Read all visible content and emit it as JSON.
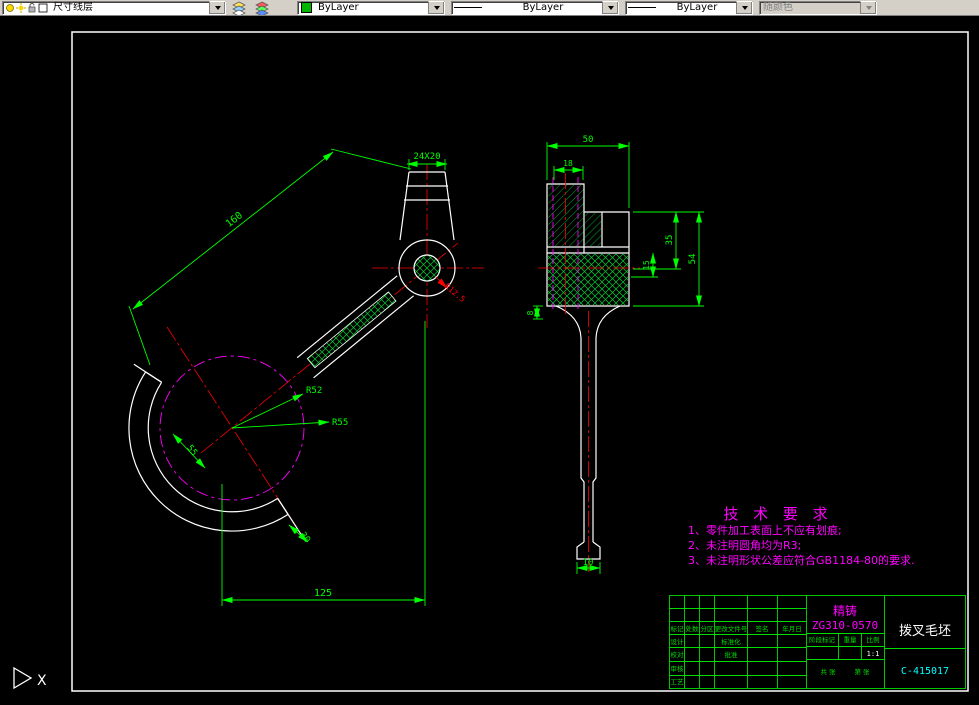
{
  "toolbar": {
    "layer_combo": "尺寸线层",
    "color_combo": "ByLayer",
    "linetype_combo": "ByLayer",
    "lineweight_combo": "ByLayer",
    "plotstyle_combo": "随颜色"
  },
  "colors": {
    "outline": "#ffffff",
    "dimension": "#00ff00",
    "centerline": "#ff0000",
    "phantom": "#ff00ff",
    "drawing_no": "#00ffff",
    "bylayer_swatch": "#00b400"
  },
  "drawing": {
    "left_view": {
      "dim_160": "160",
      "dim_24x20": "24X20",
      "dim_r125": "R12.5",
      "dim_r52": "R52",
      "dim_r55": "R55",
      "dim_55": "55",
      "dim_30": "30",
      "dim_125": "125"
    },
    "right_view": {
      "dim_50": "50",
      "dim_18": "18",
      "dim_54": "54",
      "dim_35": "35",
      "dim_15": "15",
      "dim_8": "8",
      "dim_10": "10"
    },
    "tech_requirements": {
      "title": "技 术 要 求",
      "item1": "1、零件加工表面上不应有划痕;",
      "item2": "2、未注明圆角均为R3;",
      "item3": "3、未注明形状公差应符合GB1184-80的要求."
    },
    "title_block": {
      "material_process": "精铸",
      "material_grade": "ZG310-0570",
      "part_name": "拨叉毛坯",
      "drawing_no": "C-415017",
      "scale_value": "1:1",
      "label_mark": "标记",
      "label_count": "处数",
      "label_zone": "分区",
      "label_change_doc": "更改文件号",
      "label_sign": "签名",
      "label_date": "年月日",
      "label_design": "设计",
      "label_check": "校对",
      "label_standard": "标准化",
      "label_audit": "审核",
      "label_process": "工艺",
      "label_approve": "批准",
      "label_stage": "阶段标记",
      "label_weight": "重量",
      "label_scale": "比例",
      "label_sheets": "共  张",
      "label_sheet_no": "第  张"
    },
    "ucs_label": "X"
  }
}
